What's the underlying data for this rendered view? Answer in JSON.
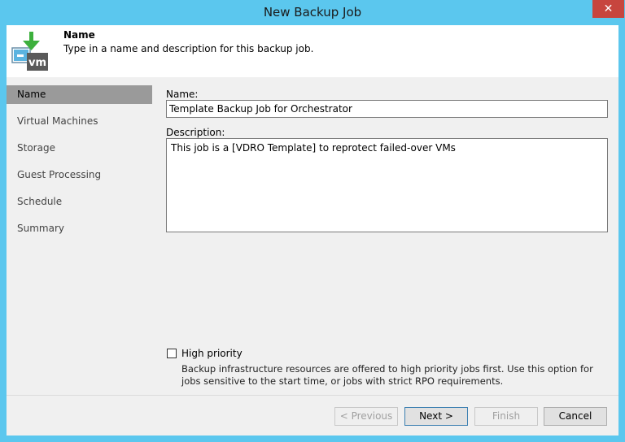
{
  "window": {
    "title": "New Backup Job",
    "close_glyph": "✕"
  },
  "header": {
    "title": "Name",
    "subtitle": "Type in a name and description for this backup job.",
    "icon": "vm-backup-icon",
    "icon_text": "vm"
  },
  "nav": {
    "items": [
      {
        "label": "Name",
        "active": true
      },
      {
        "label": "Virtual Machines"
      },
      {
        "label": "Storage"
      },
      {
        "label": "Guest Processing"
      },
      {
        "label": "Schedule"
      },
      {
        "label": "Summary"
      }
    ]
  },
  "form": {
    "name_label": "Name:",
    "name_value": "Template Backup Job for Orchestrator",
    "description_label": "Description:",
    "description_value": "This job is a [VDRO Template] to reprotect failed-over VMs",
    "high_priority_label": "High priority",
    "high_priority_checked": false,
    "high_priority_desc": "Backup infrastructure resources are offered to high priority jobs first. Use this option for jobs sensitive to the start time, or jobs with strict RPO requirements."
  },
  "buttons": {
    "previous": "< Previous",
    "next": "Next >",
    "finish": "Finish",
    "cancel": "Cancel"
  },
  "colors": {
    "frame": "#5bc7ee",
    "close": "#c7453e",
    "nav_active": "#9a9a9a",
    "arrow": "#3db03d",
    "vm_box": "#5a5a5a"
  }
}
